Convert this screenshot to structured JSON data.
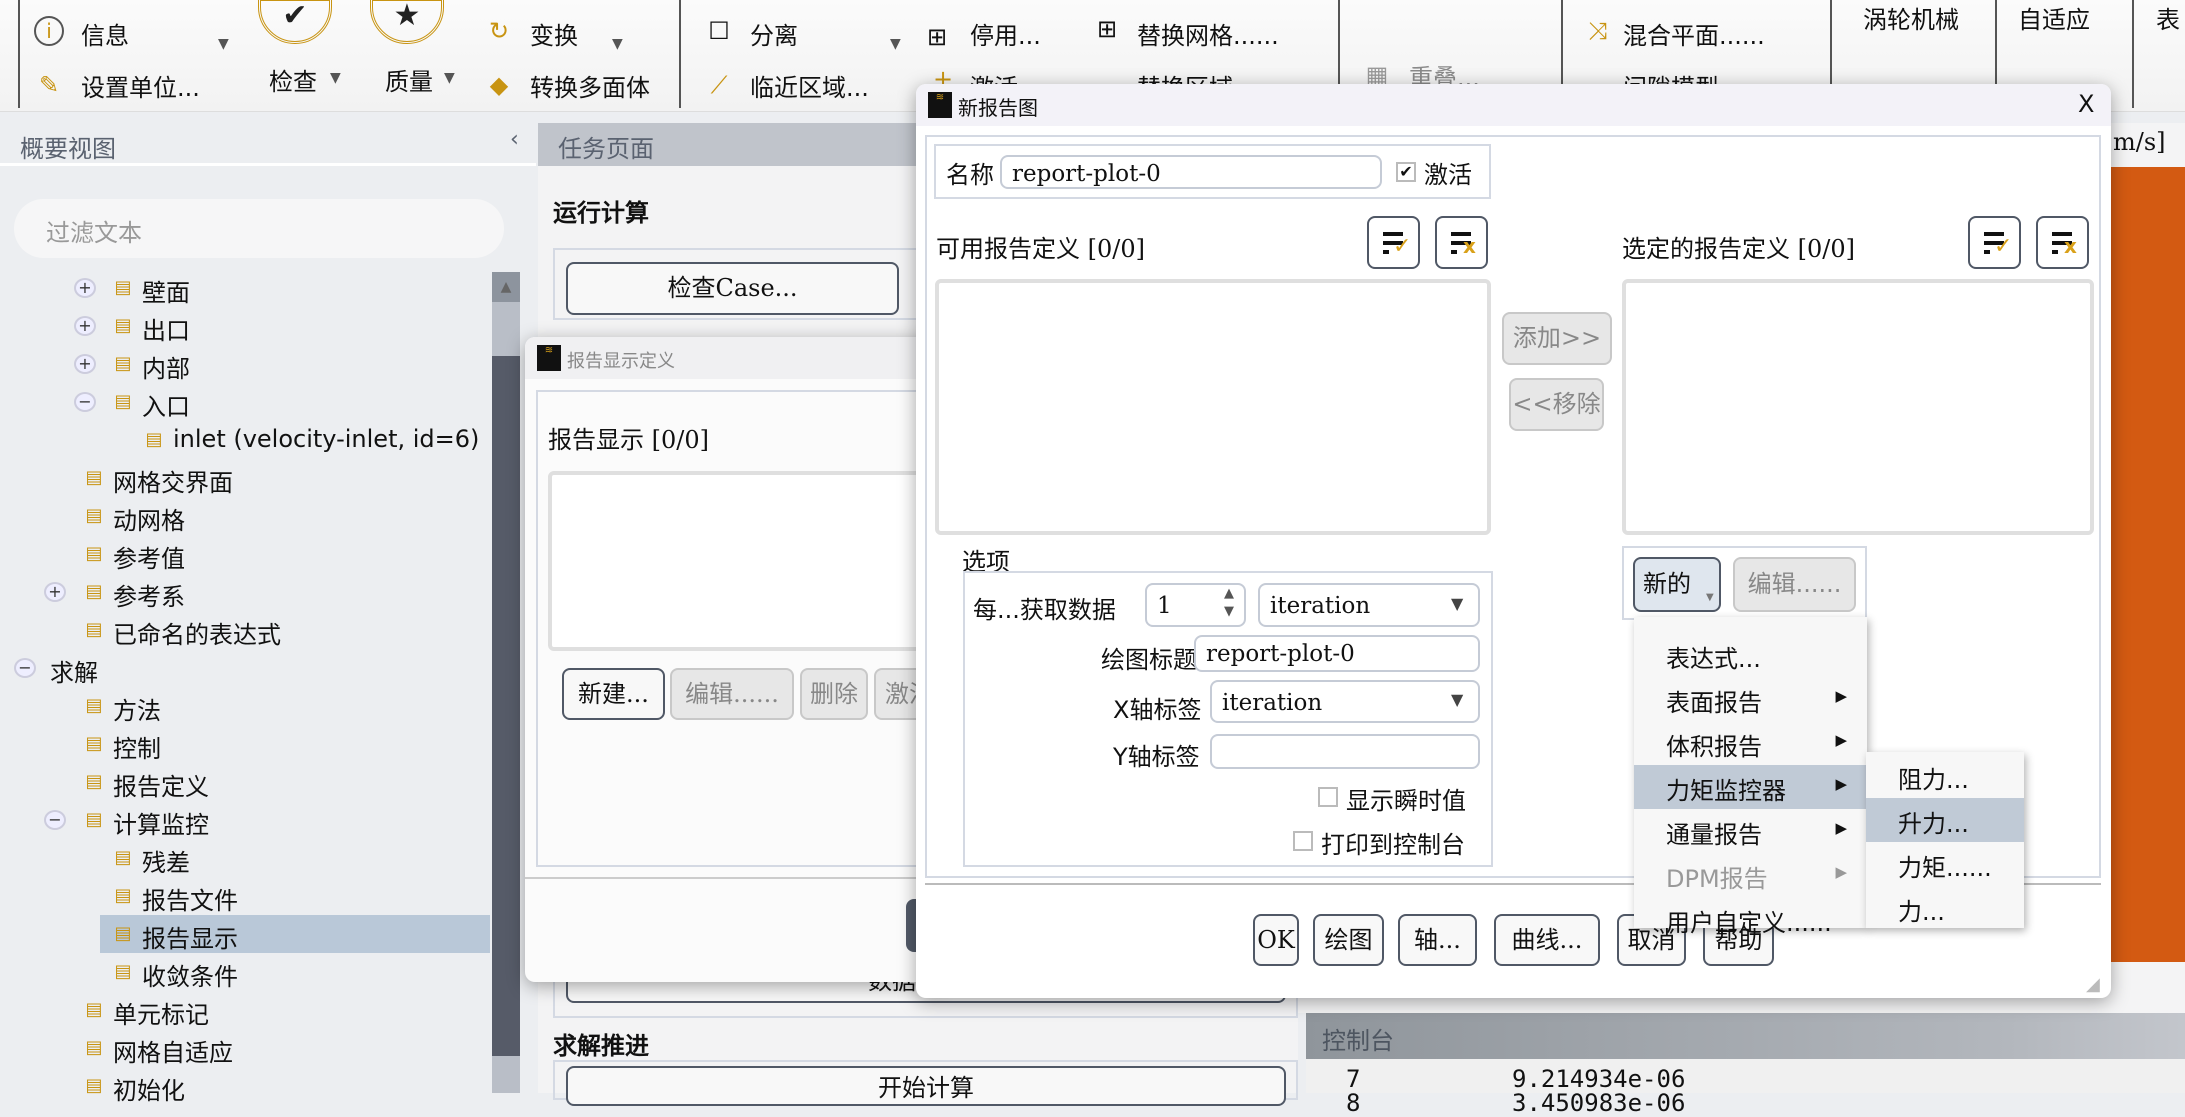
{
  "ribbon": {
    "info": "信息",
    "set_units": "设置单位...",
    "check": "检查",
    "quality": "质量",
    "transform": "变换",
    "convert_poly": "转换多面体",
    "separate": "分离",
    "adjacency": "临近区域...",
    "deactivate": "停用...",
    "activate": "激活",
    "replace_mesh": "替换网格......",
    "replace_zone": "替换区域",
    "overlap": "重叠...",
    "mixing_plane": "混合平面......",
    "gap_model": "间隙模型......",
    "turbo": "涡轮机械",
    "adapt": "自适应",
    "surface": "表"
  },
  "outline": {
    "title": "概要视图",
    "collapse": "‹",
    "filter_placeholder": "过滤文本",
    "items": [
      {
        "label": "壁面",
        "level": 2,
        "exp": "plus",
        "icon": "wall-icon"
      },
      {
        "label": "出口",
        "level": 2,
        "exp": "plus",
        "icon": "outlet-icon"
      },
      {
        "label": "内部",
        "level": 2,
        "exp": "plus",
        "icon": "interior-icon"
      },
      {
        "label": "入口",
        "level": 2,
        "exp": "minus",
        "icon": "inlet-icon"
      },
      {
        "label": "inlet (velocity-inlet, id=6)",
        "level": 3,
        "exp": null,
        "icon": "inlet-icon"
      },
      {
        "label": "网格交界面",
        "level": 1,
        "exp": null,
        "icon": "mesh-interface-icon"
      },
      {
        "label": "动网格",
        "level": 1,
        "exp": null,
        "icon": "dynamic-mesh-icon"
      },
      {
        "label": "参考值",
        "level": 1,
        "exp": null,
        "icon": "reference-values-icon"
      },
      {
        "label": "参考系",
        "level": 1,
        "exp": "plus",
        "icon": "reference-frame-icon"
      },
      {
        "label": "已命名的表达式",
        "level": 1,
        "exp": null,
        "icon": "function-icon"
      },
      {
        "label": "求解",
        "level": 0,
        "exp": "minus",
        "icon": null
      },
      {
        "label": "方法",
        "level": 1,
        "exp": null,
        "icon": "methods-icon"
      },
      {
        "label": "控制",
        "level": 1,
        "exp": null,
        "icon": "controls-icon"
      },
      {
        "label": "报告定义",
        "level": 1,
        "exp": null,
        "icon": "report-definitions-icon"
      },
      {
        "label": "计算监控",
        "level": 1,
        "exp": "minus",
        "icon": "monitors-icon"
      },
      {
        "label": "残差",
        "level": 2,
        "exp": null,
        "icon": "residuals-icon"
      },
      {
        "label": "报告文件",
        "level": 2,
        "exp": null,
        "icon": "report-file-icon"
      },
      {
        "label": "报告显示",
        "level": 2,
        "exp": null,
        "icon": "report-plot-icon",
        "selected": true
      },
      {
        "label": "收敛条件",
        "level": 2,
        "exp": null,
        "icon": "convergence-icon"
      },
      {
        "label": "单元标记",
        "level": 1,
        "exp": null,
        "icon": "cell-registers-icon"
      },
      {
        "label": "网格自适应",
        "level": 1,
        "exp": null,
        "icon": "mesh-adapt-icon"
      },
      {
        "label": "初始化",
        "level": 1,
        "exp": null,
        "icon": "initialization-icon"
      }
    ]
  },
  "task": {
    "title": "任务页面",
    "run_calc": "运行计算",
    "check_case": "检查Case...",
    "data_file": "数据文件...",
    "advance": "求解推进",
    "start": "开始计算"
  },
  "graphics": {
    "unit": "m/s]"
  },
  "report_display_dialog": {
    "title": "报告显示定义",
    "list_label": "报告显示 [0/0]",
    "new": "新建...",
    "edit": "编辑......",
    "delete": "删除",
    "activate": "激活"
  },
  "new_plot_dialog": {
    "title": "新报告图",
    "close": "X",
    "name_label": "名称",
    "name_value": "report-plot-0",
    "active_label": "激活",
    "active_checked": true,
    "available_label": "可用报告定义 [0/0]",
    "selected_label": "选定的报告定义 [0/0]",
    "add": "添加>>",
    "remove": "<<移除",
    "options_label": "选项",
    "every_label": "每...获取数据",
    "every_value": "1",
    "every_unit": "iteration",
    "plot_title_label": "绘图标题",
    "plot_title_value": "report-plot-0",
    "x_label": "X轴标签",
    "x_value": "iteration",
    "y_label": "Y轴标签",
    "y_value": "",
    "show_instant": "显示瞬时值",
    "print_console": "打印到控制台",
    "new_btn": "新的",
    "edit_btn": "编辑......",
    "buttons": {
      "ok": "OK",
      "plot": "绘图",
      "axes": "轴...",
      "curves": "曲线...",
      "cancel": "取消",
      "help": "帮助"
    }
  },
  "new_menu": {
    "items": [
      {
        "label": "表达式...",
        "sub": false
      },
      {
        "label": "表面报告",
        "sub": true
      },
      {
        "label": "体积报告",
        "sub": true
      },
      {
        "label": "力矩监控器",
        "sub": true,
        "highlighted": true
      },
      {
        "label": "通量报告",
        "sub": true
      },
      {
        "label": "DPM报告",
        "sub": true,
        "disabled": true
      },
      {
        "label": "用户自定义......",
        "sub": false
      }
    ]
  },
  "force_submenu": {
    "items": [
      {
        "label": "阻力..."
      },
      {
        "label": "升力...",
        "highlighted": true
      },
      {
        "label": "力矩......"
      },
      {
        "label": "力..."
      }
    ]
  },
  "console": {
    "title": "控制台",
    "lines": [
      {
        "iter": "7",
        "value": "9.214934e-06"
      },
      {
        "iter": "8",
        "value": "3.450983e-06"
      }
    ]
  },
  "colors": {
    "accent": "#c89412",
    "graphics_orange": "#d35a12",
    "selection": "#b9c8d8"
  }
}
